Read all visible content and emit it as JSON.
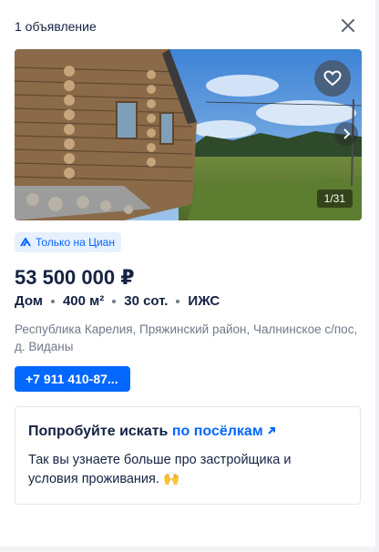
{
  "header": {
    "count": "1 объявление"
  },
  "listing": {
    "photo_counter": "1/31",
    "badge": "Только на Циан",
    "price": "53 500 000 ₽",
    "specs": [
      "Дом",
      "400 м²",
      "30 сот.",
      "ИЖС"
    ],
    "address": "Республика Карелия, Пряжинский район, Чалнинское с/пос, д. Виданы",
    "phone": "+7 911 410-87..."
  },
  "promo": {
    "title": "Попробуйте искать",
    "link": "по посёлкам",
    "text": "Так вы узнаете больше про застройщика и условия проживания.",
    "emoji": "🙌"
  },
  "colors": {
    "accent": "#0468ff",
    "text": "#152242",
    "muted": "#707a89",
    "badge_bg": "#e6f0ff"
  }
}
